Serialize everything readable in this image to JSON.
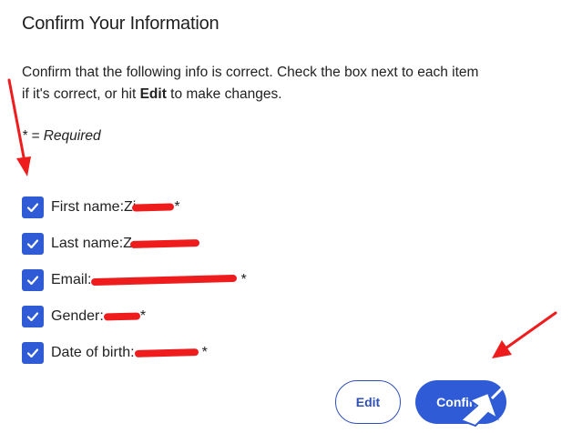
{
  "header": {
    "title": "Confirm Your Information"
  },
  "intro": {
    "line1": "Confirm that the following info is correct. Check the box next to each item",
    "line2_prefix": "if it's correct, or hit ",
    "line2_bold": "Edit",
    "line2_suffix": " to make changes."
  },
  "required_note": "* = Required",
  "items": [
    {
      "label": "First name:",
      "value_visible": "Zi",
      "required_mark": "*",
      "checked": true
    },
    {
      "label": "Last name:",
      "value_visible": "Z",
      "required_mark": "",
      "checked": true
    },
    {
      "label": "Email:",
      "value_visible": "",
      "required_mark": "*",
      "checked": true
    },
    {
      "label": "Gender:",
      "value_visible": "",
      "required_mark": "*",
      "checked": true
    },
    {
      "label": "Date of birth:",
      "value_visible": "",
      "required_mark": "*",
      "checked": true
    }
  ],
  "buttons": {
    "edit_label": "Edit",
    "confirm_label": "Confirm"
  },
  "colors": {
    "accent": "#2f5bd6",
    "edit_outline": "#2f4fb8",
    "annotation_red": "#ee1c1c"
  },
  "icons": {
    "checkbox": "checkmark-icon",
    "cursor": "cursor-icon"
  }
}
